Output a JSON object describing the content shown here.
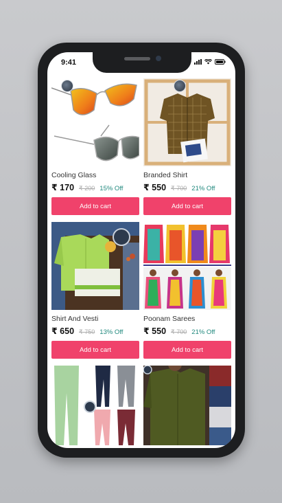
{
  "status_bar": {
    "time": "9:41"
  },
  "products": [
    {
      "name": "Cooling Glass",
      "price": "₹ 170",
      "mrp": "₹ 200",
      "off": "15% Off",
      "button": "Add to cart"
    },
    {
      "name": "Branded Shirt",
      "price": "₹ 550",
      "mrp": "₹ 700",
      "off": "21% Off",
      "button": "Add to cart"
    },
    {
      "name": "Shirt And Vesti",
      "price": "₹ 650",
      "mrp": "₹ 750",
      "off": "13% Off",
      "button": "Add to cart"
    },
    {
      "name": "Poonam Sarees",
      "price": "₹ 550",
      "mrp": "₹ 700",
      "off": "21% Off",
      "button": "Add to cart"
    }
  ],
  "colors": {
    "accent": "#f0426b",
    "discount": "#21897e"
  }
}
